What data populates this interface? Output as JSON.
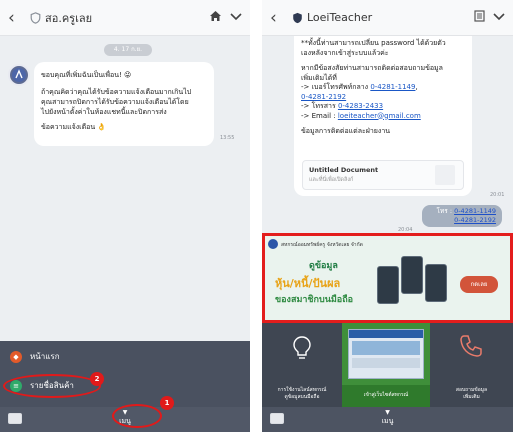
{
  "left": {
    "header": {
      "title": "สอ.ครูเลย"
    },
    "date_pill": "4. 17 ก.ย.",
    "message": {
      "greeting": "ขอบคุณที่เพิ่มฉันเป็นเพื่อน! 😜",
      "line1": "ถ้าคุณคิดว่าคุณได้รับข้อความแจ้งเตือนมากเกินไป",
      "line2": "คุณสามารถปิดการได้รับข้อความแจ้งเตือนได้โดย",
      "line3": "ไปยังหน้าตั้งค่าในห้องแชทนี้และปิดการส่ง",
      "line4": "ข้อความแจ้งเตือน 👌",
      "time": "13:55"
    },
    "menu": {
      "items": [
        {
          "label": "หน้าแรก"
        },
        {
          "label": "รายชื่อสินค้า"
        }
      ],
      "toggle_label": "เมนู"
    },
    "annotations": {
      "one": "1",
      "two": "2"
    }
  },
  "right": {
    "header": {
      "title": "LoeiTeacher"
    },
    "card": {
      "line1": "**ทั้งนี้ท่านสามารถเปลี่ยน password ได้ด้วยตัว",
      "line2": "เองหลังจากเข้าสู่ระบบแล้วค่ะ",
      "line3": "หากมีข้อสงสัยท่านสามารถติดต่อสอบถามข้อมูล",
      "line4": "เพิ่มเติมได้ที่",
      "phone_prefix": "-> เบอร์โทรศัพท์กลาง ",
      "phone1": "0-4281-1149",
      "phone_sep": ",",
      "phone2": "0-4281-2192",
      "fax_prefix": "-> โทรสาร ",
      "fax": "0-4283-2433",
      "email_prefix": "-> Email : ",
      "email": "loeiteacher@gmail.com",
      "contact_heading": "ข้อมูลการติดต่อแต่ละฝ่ายงาน",
      "doc_title": "Untitled Document",
      "doc_sub": "และที่นี่เพื่อเปิดลิงก์",
      "time": "20:01"
    },
    "user_msg": {
      "prefix": "โทร : ",
      "phone1": "0-4281-1149",
      "phone2": "0-4281-2192",
      "time": "20:04"
    },
    "banner": {
      "head": "สหกรณ์ออมทรัพย์ครู จังหวัดเลย จำกัด",
      "t1": "ดูข้อมูล",
      "t2": "หุ้น/หนี้/ปันผล",
      "t3": "ของสมาชิกบนมือถือ",
      "cta": "กดเลย"
    },
    "rich_menu": {
      "left_label_1": "การใช้งานไลน์สหกรณ์",
      "left_label_2": "ดูข้อมูลบนมือถือ",
      "mid_label": "เข้าสู่เว็บไซต์สหกรณ์",
      "right_label_1": "สอบถามข้อมูล",
      "right_label_2": "เพิ่มเติม"
    },
    "toggle_label": "เมนู"
  }
}
